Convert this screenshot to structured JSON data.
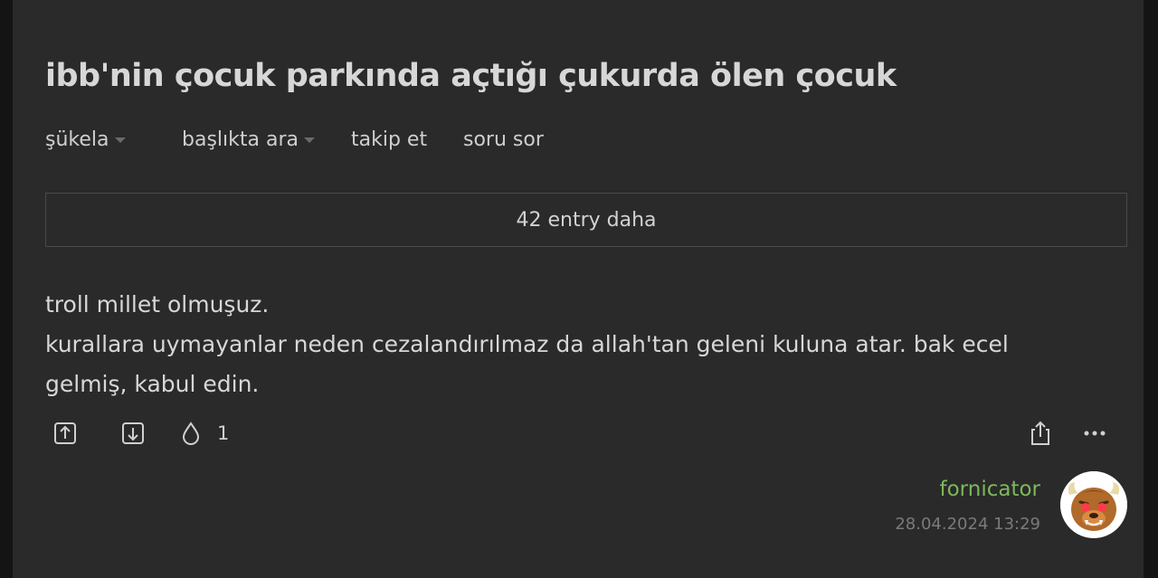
{
  "topic": {
    "title": "ibb'nin çocuk parkında açtığı çukurda ölen çocuk"
  },
  "tabs": {
    "sort_label": "şükela",
    "search_label": "başlıkta ara",
    "follow_label": "takip et",
    "ask_label": "soru sor"
  },
  "more_entries": {
    "label": "42 entry daha"
  },
  "entry": {
    "line1": "troll millet olmuşuz.",
    "line2": "kurallara uymayanlar neden cezalandırılmaz da allah'tan geleni kuluna atar. bak ecel gelmiş, kabul edin.",
    "fav_count": "1",
    "author": "fornicator",
    "date": "28.04.2024 13:29"
  },
  "icons": {
    "upvote": "upvote-icon",
    "downvote": "downvote-icon",
    "favorite": "drop-icon",
    "share": "share-icon",
    "more": "more-icon",
    "avatar": "beast-avatar"
  },
  "colors": {
    "background": "#2a2a2a",
    "text": "#d7d7d7",
    "author": "#7db85c",
    "date": "#7a7a7a"
  }
}
